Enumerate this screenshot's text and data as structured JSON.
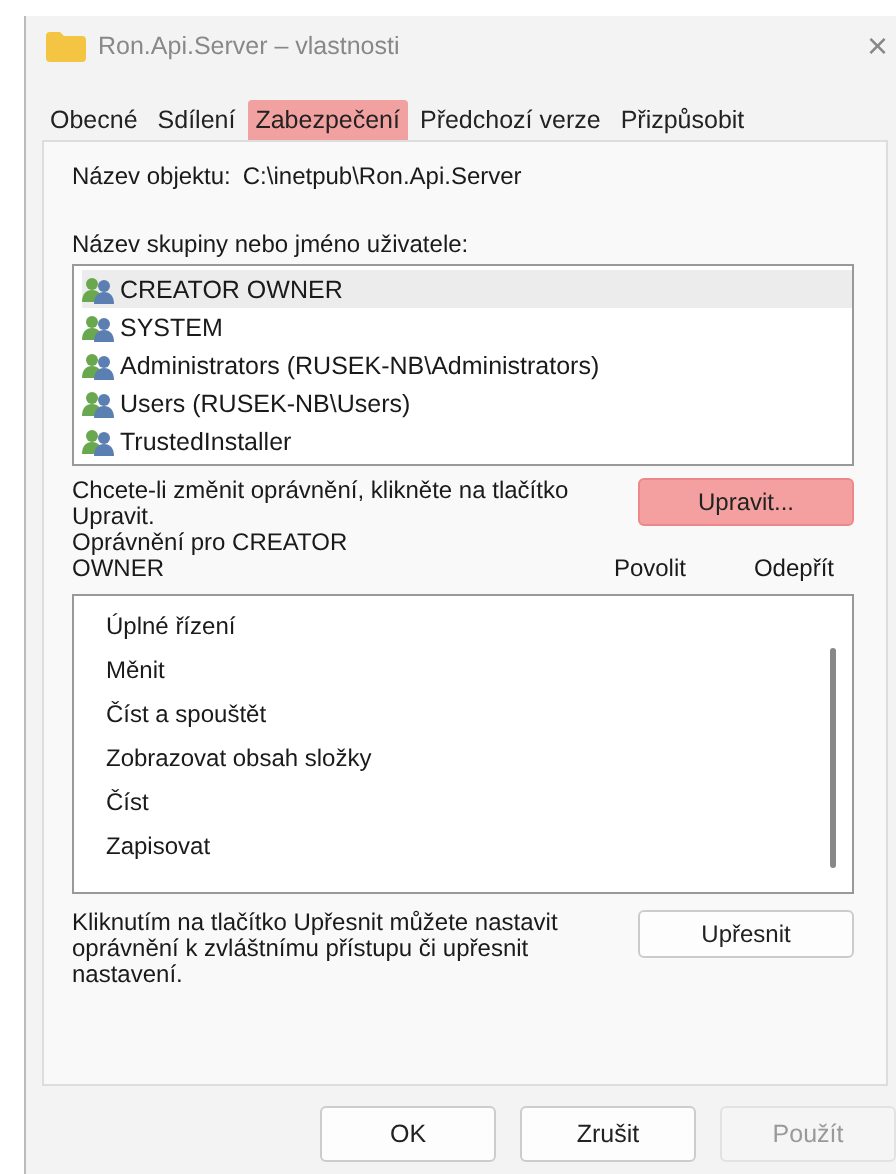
{
  "window": {
    "title": "Ron.Api.Server – vlastnosti",
    "close": "×"
  },
  "tabs": [
    {
      "label": "Obecné",
      "selected": false
    },
    {
      "label": "Sdílení",
      "selected": false
    },
    {
      "label": "Zabezpečení",
      "selected": true
    },
    {
      "label": "Předchozí verze",
      "selected": false
    },
    {
      "label": "Přizpůsobit",
      "selected": false
    }
  ],
  "object_name": {
    "label": "Název objektu:",
    "value": "C:\\inetpub\\Ron.Api.Server"
  },
  "groups": {
    "label": "Název skupiny nebo jméno uživatele:",
    "items": [
      {
        "name": "CREATOR OWNER",
        "selected": true
      },
      {
        "name": "SYSTEM",
        "selected": false
      },
      {
        "name": "Administrators (RUSEK-NB\\Administrators)",
        "selected": false
      },
      {
        "name": "Users (RUSEK-NB\\Users)",
        "selected": false
      },
      {
        "name": "TrustedInstaller",
        "selected": false
      }
    ]
  },
  "edit_hint": "Chcete-li změnit oprávnění, klikněte na tlačítko Upravit.",
  "edit_button": {
    "label": "Upravit...",
    "highlighted": true
  },
  "permissions": {
    "title": "Oprávnění pro CREATOR OWNER",
    "columns": [
      "Povolit",
      "Odepřít"
    ],
    "items": [
      "Úplné řízení",
      "Měnit",
      "Číst a spouštět",
      "Zobrazovat obsah složky",
      "Číst",
      "Zapisovat"
    ]
  },
  "advanced_hint": "Kliknutím na tlačítko Upřesnit můžete nastavit oprávnění k zvláštnímu přístupu či upřesnit nastavení.",
  "advanced_button": {
    "label": "Upřesnit"
  },
  "buttons": [
    {
      "label": "OK",
      "disabled": false
    },
    {
      "label": "Zrušit",
      "disabled": false
    },
    {
      "label": "Použít",
      "disabled": true
    }
  ]
}
